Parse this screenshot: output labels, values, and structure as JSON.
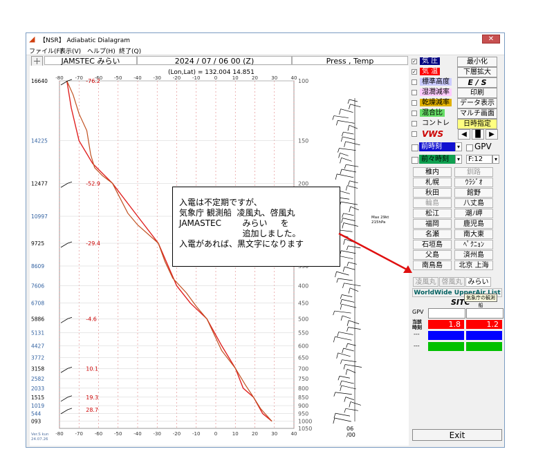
{
  "window": {
    "icon": "app-logo-icon",
    "title": "【NSR】 Adiabatic Dialagram",
    "close_label": "✕"
  },
  "menu": [
    "ファイル(F)",
    "表示(V)",
    "ヘルプ(H)",
    "終了(Q)"
  ],
  "header": {
    "station": "JAMSTEC みらい",
    "date": "2024 / 07 / 06 00 (Z)",
    "mode": "Press , Temp",
    "lonlat": "(Lon,Lat) = 132.004 14.851"
  },
  "plot": {
    "x_ticks": [
      "-80",
      "-70",
      "-60",
      "-50",
      "-40",
      "-30",
      "-20",
      "-10",
      "0",
      "10",
      "20",
      "30",
      "40"
    ],
    "pressure_ticks": [
      {
        "p": 100,
        "label": "100"
      },
      {
        "p": 150,
        "label": "150"
      },
      {
        "p": 200,
        "label": "200"
      },
      {
        "p": 250,
        "label": "250"
      },
      {
        "p": 300,
        "label": "300"
      },
      {
        "p": 350,
        "label": "350"
      },
      {
        "p": 400,
        "label": "400"
      },
      {
        "p": 450,
        "label": "450"
      },
      {
        "p": 500,
        "label": "500"
      },
      {
        "p": 550,
        "label": "550"
      },
      {
        "p": 600,
        "label": "600"
      },
      {
        "p": 650,
        "label": "650"
      },
      {
        "p": 700,
        "label": "700"
      },
      {
        "p": 750,
        "label": "750"
      },
      {
        "p": 800,
        "label": "800"
      },
      {
        "p": 850,
        "label": "850"
      },
      {
        "p": 900,
        "label": "900"
      },
      {
        "p": 950,
        "label": "950"
      },
      {
        "p": 1000,
        "label": "1000"
      },
      {
        "p": 1050,
        "label": "1050"
      }
    ],
    "height_ticks": [
      {
        "p": 100,
        "label": "16640"
      },
      {
        "p": 150,
        "label": "14225"
      },
      {
        "p": 200,
        "label": "12477"
      },
      {
        "p": 250,
        "label": "10997"
      },
      {
        "p": 300,
        "label": "9725"
      },
      {
        "p": 350,
        "label": "8609"
      },
      {
        "p": 400,
        "label": "7606"
      },
      {
        "p": 450,
        "label": "6708"
      },
      {
        "p": 500,
        "label": "5886"
      },
      {
        "p": 550,
        "label": "5131"
      },
      {
        "p": 600,
        "label": "4427"
      },
      {
        "p": 650,
        "label": "3772"
      },
      {
        "p": 700,
        "label": "3158"
      },
      {
        "p": 750,
        "label": "2582"
      },
      {
        "p": 800,
        "label": "2033"
      },
      {
        "p": 850,
        "label": "1515"
      },
      {
        "p": 900,
        "label": "1019"
      },
      {
        "p": 950,
        "label": "544"
      },
      {
        "p": 1000,
        "label": "093"
      }
    ],
    "temp_labels": [
      {
        "p": 100,
        "label": "-76.2"
      },
      {
        "p": 200,
        "label": "-52.9"
      },
      {
        "p": 300,
        "label": "-29.4"
      },
      {
        "p": 500,
        "label": "-4.6"
      },
      {
        "p": 700,
        "label": "10.1"
      },
      {
        "p": 850,
        "label": "19.3"
      },
      {
        "p": 925,
        "label": "28.7"
      }
    ],
    "max_wind": "Max 29kt\n215hPa",
    "time_label": "06\n/00",
    "version": "Ver.S  kun\n24.07.26",
    "colors": {
      "temp": "#e02020",
      "profile": "#c05020",
      "grid": "#e08080",
      "wind": "#000000"
    }
  },
  "chart_data": {
    "type": "line",
    "title": "",
    "xlabel": "",
    "ylabel": "",
    "xlim": [
      -80,
      40
    ],
    "ylim": [
      1050,
      100
    ],
    "y_scale": "log",
    "series": [
      {
        "points": [
          [
            28.7,
            1000
          ],
          [
            24,
            950
          ],
          [
            19.3,
            850
          ],
          [
            14,
            800
          ],
          [
            10.1,
            700
          ],
          [
            3,
            600
          ],
          [
            -4.6,
            500
          ],
          [
            -13,
            450
          ],
          [
            -20,
            400
          ],
          [
            -29.4,
            300
          ],
          [
            -40,
            250
          ],
          [
            -52.9,
            200
          ],
          [
            -63,
            175
          ],
          [
            -70,
            150
          ],
          [
            -74,
            120
          ],
          [
            -76.2,
            100
          ]
        ]
      },
      {
        "points": [
          [
            28.7,
            1000
          ],
          [
            23,
            920
          ],
          [
            19.3,
            850
          ],
          [
            15,
            780
          ],
          [
            10.1,
            700
          ],
          [
            3,
            620
          ],
          [
            -4.6,
            500
          ],
          [
            -10,
            460
          ],
          [
            -15,
            420
          ],
          [
            -22,
            380
          ],
          [
            -26,
            340
          ],
          [
            -29.4,
            300
          ],
          [
            -40,
            265
          ],
          [
            -45,
            245
          ],
          [
            -52.9,
            200
          ],
          [
            -58,
            190
          ],
          [
            -62,
            180
          ],
          [
            -64,
            165
          ],
          [
            -66,
            140
          ],
          [
            -70,
            125
          ],
          [
            -73,
            110
          ],
          [
            -76.2,
            100
          ]
        ]
      }
    ]
  },
  "right_panel": {
    "checks": [
      {
        "label": "気 圧",
        "checked": true,
        "bg": "#000080",
        "fg": "#ffffff"
      },
      {
        "label": "気 温",
        "checked": true,
        "bg": "#ff0000",
        "fg": "#ffffff"
      },
      {
        "label": "標準高度",
        "checked": false,
        "bg": "#ccccff",
        "fg": "#000000"
      },
      {
        "label": "湿潤減率",
        "checked": false,
        "bg": "#ffccff",
        "fg": "#000000"
      },
      {
        "label": "乾燥減率",
        "checked": false,
        "bg": "#e0b000",
        "fg": "#000000"
      },
      {
        "label": "混合比",
        "checked": false,
        "bg": "#66dd66",
        "fg": "#000000"
      },
      {
        "label": "コントレール",
        "checked": false,
        "bg": "#f0f0f0",
        "fg": "#000000"
      },
      {
        "label": "VWS",
        "checked": false,
        "bg": "#f0f0f0",
        "fg": "#cc0000"
      }
    ],
    "buttons": [
      "最小化",
      "下層拡大",
      "E / S",
      "印刷",
      "データ表示",
      "マルチ画面",
      "日時指定"
    ],
    "nav": [
      "◀",
      "▐▌",
      "▶"
    ],
    "prev1": "前時刻",
    "prev2": "前々時刻",
    "gpv": "GPV",
    "f_value": "F:12",
    "cities": [
      [
        "稚内",
        "釧路"
      ],
      [
        "札幌",
        "ｳﾗｼﾞｵ"
      ],
      [
        "秋田",
        "館野"
      ],
      [
        "輪島",
        "八丈島"
      ],
      [
        "松江",
        "潮ﾉ岬"
      ],
      [
        "福岡",
        "鹿児島"
      ],
      [
        "名瀬",
        "南大東"
      ],
      [
        "石垣島",
        "ﾍﾟｸﾆｮﾝ"
      ],
      [
        "父島",
        "済州島"
      ],
      [
        "南鳥島",
        "北京 上海"
      ]
    ],
    "ship_tabs": [
      "凌風丸",
      "啓風丸",
      "みらい"
    ],
    "links": "WorldWide UpperAir List",
    "sitc": "SITC",
    "gpv_row": "GPV",
    "red_left": "1.8",
    "red_right": "1.2",
    "row_label": "当該\n時刻",
    "dash1": "---",
    "dash2": "---",
    "tooltip": "気象庁の観測船",
    "exit": "Exit"
  },
  "popup": {
    "lines": [
      "入電は不定期ですが、",
      "気象庁 観測船  凌風丸、啓風丸",
      "JAMASTEC        みらい     を",
      "                        追加しました。",
      "入電があれば、黒文字になります"
    ]
  }
}
